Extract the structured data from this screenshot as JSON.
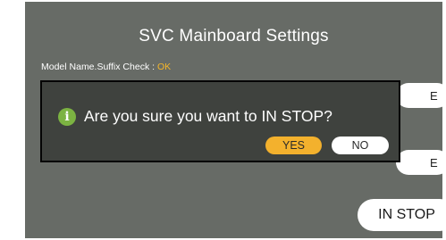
{
  "screen": {
    "title": "SVC Mainboard Settings",
    "model_check_label": "Model Name.Suffix Check : ",
    "model_check_status": "OK"
  },
  "side_buttons": {
    "top_partial_label": "E",
    "mid_partial_label": "E",
    "in_stop_label": "IN STOP"
  },
  "dialog": {
    "icon": "info-icon",
    "message": "Are you sure you want to IN STOP?",
    "yes_label": "YES",
    "no_label": "NO"
  },
  "colors": {
    "screen_bg": "#676b66",
    "dialog_bg": "#3f423e",
    "accent": "#f3b12d",
    "ok_text": "#f5b62a",
    "info_icon": "#7cb342"
  }
}
